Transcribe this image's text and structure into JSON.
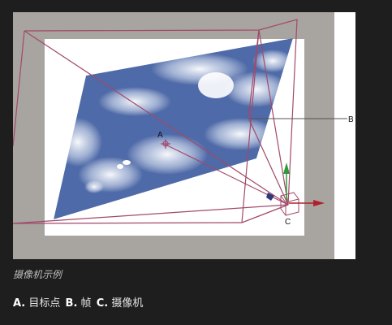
{
  "figure": {
    "label_a": "A",
    "label_b": "B",
    "label_c": "C",
    "colors": {
      "background": "#1e1e1e",
      "gray_frame": "#a8a49f",
      "sky_blue": "#4e6aa8",
      "wire": "#a2496a",
      "axis_green": "#2f9a3c",
      "axis_red": "#b0202c"
    }
  },
  "caption": "摄像机示例",
  "legend": [
    {
      "key": "A.",
      "text": "目标点"
    },
    {
      "key": "B.",
      "text": "帧"
    },
    {
      "key": "C.",
      "text": "摄像机"
    }
  ]
}
